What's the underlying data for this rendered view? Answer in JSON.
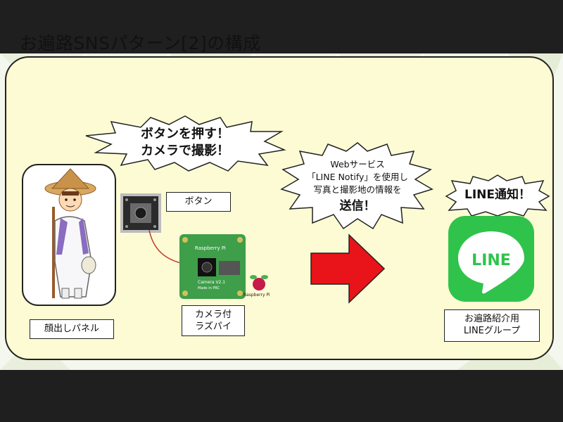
{
  "slide": {
    "title": "お遍路SNSパターン[2]の構成"
  },
  "bubbles": {
    "press": "ボタンを押す！\nカメラで撮影！",
    "web": "Webサービス\n「LINE Notify」を使用し\n写真と撮影地の情報を",
    "web_send": "送信！",
    "notify": "LINE通知！"
  },
  "labels": {
    "button": "ボタン",
    "camera": "カメラ付\nラズパイ",
    "panel": "顔出しパネル",
    "group": "お遍路紹介用\nLINEグループ"
  },
  "line_logo": {
    "text": "LINE",
    "color": "#2fc34b"
  },
  "raspberry": {
    "board_text": "Raspberry Pi",
    "camera_text": "Camera V2.1",
    "made_in": "Made in PRC",
    "logo_text": "Raspberry Pi"
  },
  "colors": {
    "arrow": "#e8141a",
    "panel_bg": "#fdfbd3",
    "board": "#3f9e4a"
  }
}
